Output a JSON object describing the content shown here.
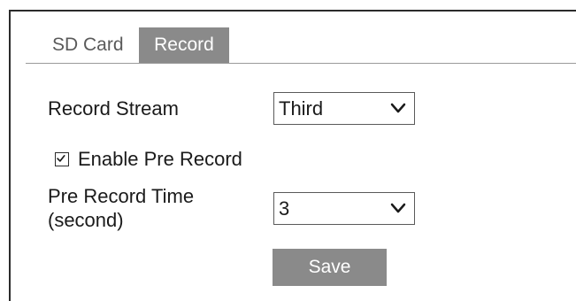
{
  "tabs": [
    {
      "label": "SD Card",
      "active": false
    },
    {
      "label": "Record",
      "active": true
    }
  ],
  "form": {
    "record_stream": {
      "label": "Record Stream",
      "value": "Third"
    },
    "enable_pre_record": {
      "label": "Enable Pre Record",
      "checked": true
    },
    "pre_record_time": {
      "label_line1": "Pre Record Time",
      "label_line2": "(second)",
      "value": "3"
    },
    "save_label": "Save"
  },
  "colors": {
    "active_tab_bg": "#8a8a8a",
    "button_bg": "#8a8a8a",
    "text": "#1a1a1a"
  }
}
